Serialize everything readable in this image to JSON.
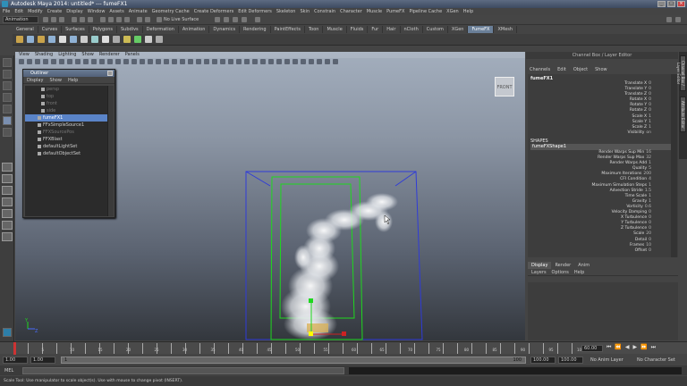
{
  "title": "Autodesk Maya 2014: untitled*   ---   fumeFX1",
  "menu": [
    "File",
    "Edit",
    "Modify",
    "Create",
    "Display",
    "Window",
    "Assets",
    "Animate",
    "Geometry Cache",
    "Create Deformers",
    "Edit Deformers",
    "Skeleton",
    "Skin",
    "Constrain",
    "Character",
    "Muscle",
    "PumeFX",
    "Pipeline Cache",
    "XGen",
    "Help"
  ],
  "status": {
    "mode": "Animation",
    "live": "No Live Surface"
  },
  "shelf_tabs": [
    "General",
    "Curves",
    "Surfaces",
    "Polygons",
    "Subdivs",
    "Deformation",
    "Animation",
    "Dynamics",
    "Rendering",
    "PaintEffects",
    "Toon",
    "Muscle",
    "Fluids",
    "Fur",
    "Hair",
    "nCloth",
    "Custom",
    "XGen",
    "FumeFX",
    "XMesh"
  ],
  "shelf_active": "FumeFX",
  "viewport": {
    "menu": [
      "View",
      "Shading",
      "Lighting",
      "Show",
      "Renderer",
      "Panels"
    ],
    "viewcube_label": "FRONT",
    "axis_y": "Y",
    "axis_z": "Z"
  },
  "outliner": {
    "title": "Outliner",
    "menu": [
      "Display",
      "Show",
      "Help"
    ],
    "items": [
      {
        "label": "persp",
        "dim": true
      },
      {
        "label": "top",
        "dim": true
      },
      {
        "label": "front",
        "dim": true
      },
      {
        "label": "side",
        "dim": true
      },
      {
        "label": "fumeFX1",
        "selected": true
      },
      {
        "label": "FFxSimpleSource1",
        "dim": false
      },
      {
        "label": "FFXSourcePos",
        "dim": true
      },
      {
        "label": "FFXBlast",
        "dim": false
      },
      {
        "label": "defaultLightSet",
        "dim": false
      },
      {
        "label": "defaultObjectSet",
        "dim": false
      }
    ]
  },
  "channel_box": {
    "title": "Channel Box / Layer Editor",
    "menu": [
      "Channels",
      "Edit",
      "Object",
      "Show"
    ],
    "node": "fumeFX1",
    "transform_attrs": [
      {
        "name": "Translate X",
        "value": "0"
      },
      {
        "name": "Translate Y",
        "value": "0"
      },
      {
        "name": "Translate Z",
        "value": "0"
      },
      {
        "name": "Rotate X",
        "value": "0"
      },
      {
        "name": "Rotate Y",
        "value": "0"
      },
      {
        "name": "Rotate Z",
        "value": "0"
      },
      {
        "name": "Scale X",
        "value": "1"
      },
      {
        "name": "Scale Y",
        "value": "1"
      },
      {
        "name": "Scale Z",
        "value": "1"
      },
      {
        "name": "Visibility",
        "value": "on"
      }
    ],
    "shapes_label": "SHAPES",
    "shape_node": "fumeFXShape1",
    "shape_attrs": [
      {
        "name": "Render Warps Sup Min",
        "value": "16"
      },
      {
        "name": "Render Warps Sup Max",
        "value": "32"
      },
      {
        "name": "Render Warps Add",
        "value": "1"
      },
      {
        "name": "Quality",
        "value": "5"
      },
      {
        "name": "Maximum Iterations",
        "value": "200"
      },
      {
        "name": "CFI Condition",
        "value": "4"
      },
      {
        "name": "Maximum Simulation Steps",
        "value": "1"
      },
      {
        "name": "Advection Stride",
        "value": "1.5"
      },
      {
        "name": "Time Scale",
        "value": "1"
      },
      {
        "name": "Gravity",
        "value": "1"
      },
      {
        "name": "Vorticity",
        "value": "0.6"
      },
      {
        "name": "Velocity Damping",
        "value": "0"
      },
      {
        "name": "X Turbulence",
        "value": "0"
      },
      {
        "name": "Y Turbulence",
        "value": "0"
      },
      {
        "name": "Z Turbulence",
        "value": "0"
      },
      {
        "name": "Scale",
        "value": "20"
      },
      {
        "name": "Detail",
        "value": "0"
      },
      {
        "name": "Frames",
        "value": "10"
      },
      {
        "name": "Offset",
        "value": "0"
      }
    ]
  },
  "layer_editor": {
    "tabs": [
      "Display",
      "Render",
      "Anim"
    ],
    "active": "Display",
    "menu": [
      "Layers",
      "Options",
      "Help"
    ]
  },
  "side_tabs": [
    "Channel Box / Layer Editor",
    "Attribute Editor"
  ],
  "timeline": {
    "current_frame": "1",
    "end_frame": "60.00",
    "tick_labels": [
      "1",
      "5",
      "10",
      "15",
      "20",
      "25",
      "30",
      "35",
      "40",
      "45",
      "50",
      "55",
      "60",
      "65",
      "70",
      "75",
      "80",
      "85",
      "90",
      "95",
      "100"
    ]
  },
  "range": {
    "start": "1.00",
    "start2": "1.00",
    "bar_start": "1",
    "bar_end": "100",
    "end": "100.00",
    "end2": "100.00",
    "anim_layer": "No Anim Layer",
    "char_set": "No Character Set"
  },
  "mel_label": "MEL",
  "help_line": "Scale Tool: Use manipulator to scale object(s). Use with mouse to change pivot (INSERT).",
  "colors": {
    "accent": "#6a7f98",
    "selection": "#5a84c8",
    "bbox_outer": "#2f3bd8",
    "bbox_inner": "#1ed81e"
  }
}
